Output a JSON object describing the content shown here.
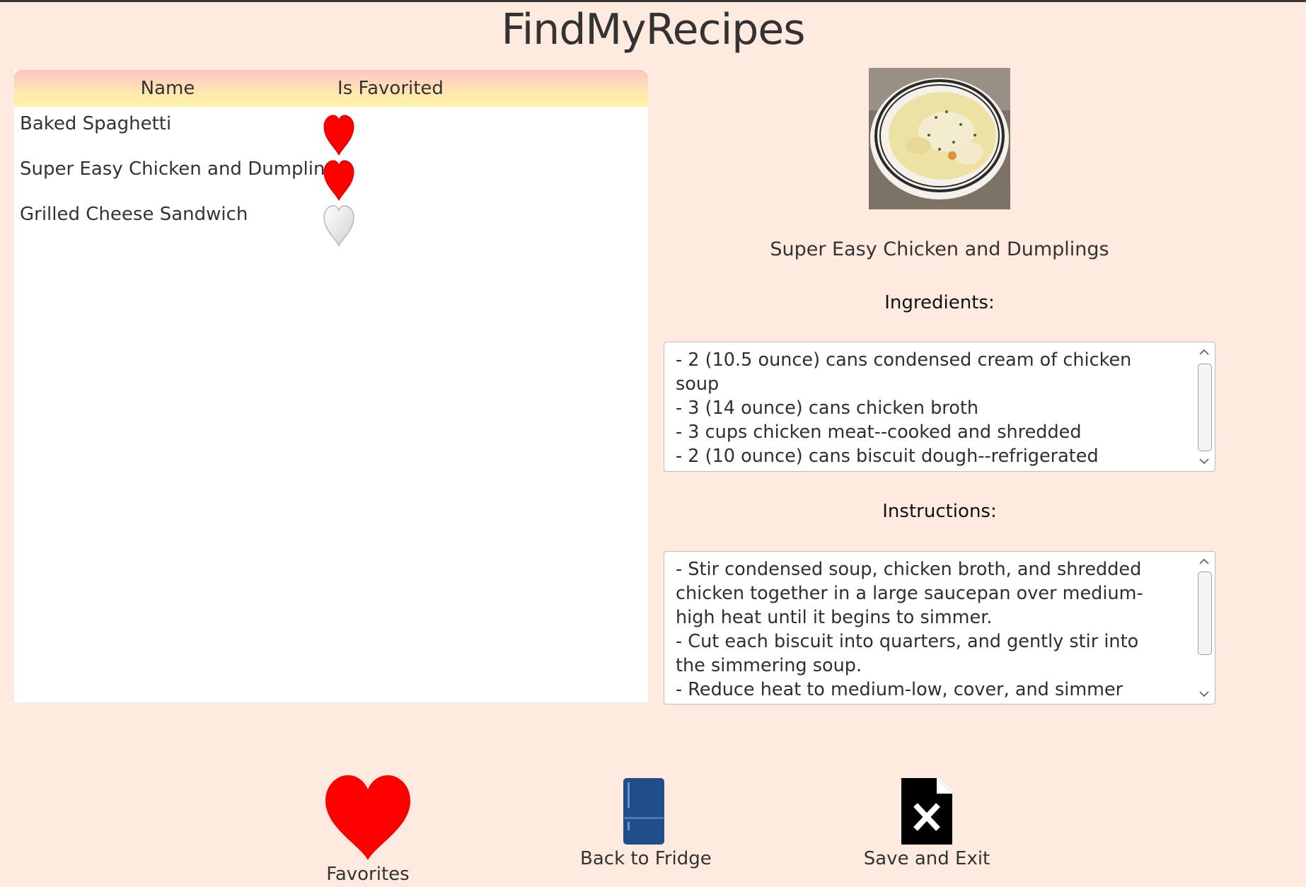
{
  "app": {
    "title": "FindMyRecipes"
  },
  "table": {
    "columns": [
      "Name",
      "Is Favorited"
    ],
    "rows": [
      {
        "name": "Baked Spaghetti",
        "favorited": true
      },
      {
        "name": "Super Easy Chicken and Dumplings",
        "favorited": true
      },
      {
        "name": "Grilled Cheese Sandwich",
        "favorited": false
      }
    ]
  },
  "detail": {
    "recipe_name": "Super Easy Chicken and Dumplings",
    "ingredients_label": "Ingredients:",
    "ingredients_text": "- 2 (10.5 ounce) cans condensed cream of chicken soup\n- 3 (14 ounce) cans chicken broth\n- 3 cups chicken meat--cooked and shredded\n- 2 (10 ounce) cans biscuit dough--refrigerated",
    "instructions_label": "Instructions:",
    "instructions_text": "- Stir condensed soup, chicken broth, and shredded chicken together in a large saucepan over medium-high heat until it begins to simmer.\n- Cut each biscuit into quarters, and gently stir into the simmering soup.\n- Reduce heat to medium-low, cover, and simmer until biscuits are"
  },
  "nav": {
    "favorites_label": "Favorites",
    "fridge_label": "Back to Fridge",
    "save_exit_label": "Save and Exit"
  },
  "colors": {
    "background": "#feeadf",
    "heart_favorited": "#ff0000",
    "heart_unfavorited": "#e6e6e6",
    "fridge": "#1f4e89"
  },
  "icons": {
    "favorite": "heart-icon",
    "fridge": "fridge-icon",
    "save_exit": "file-close-icon"
  }
}
